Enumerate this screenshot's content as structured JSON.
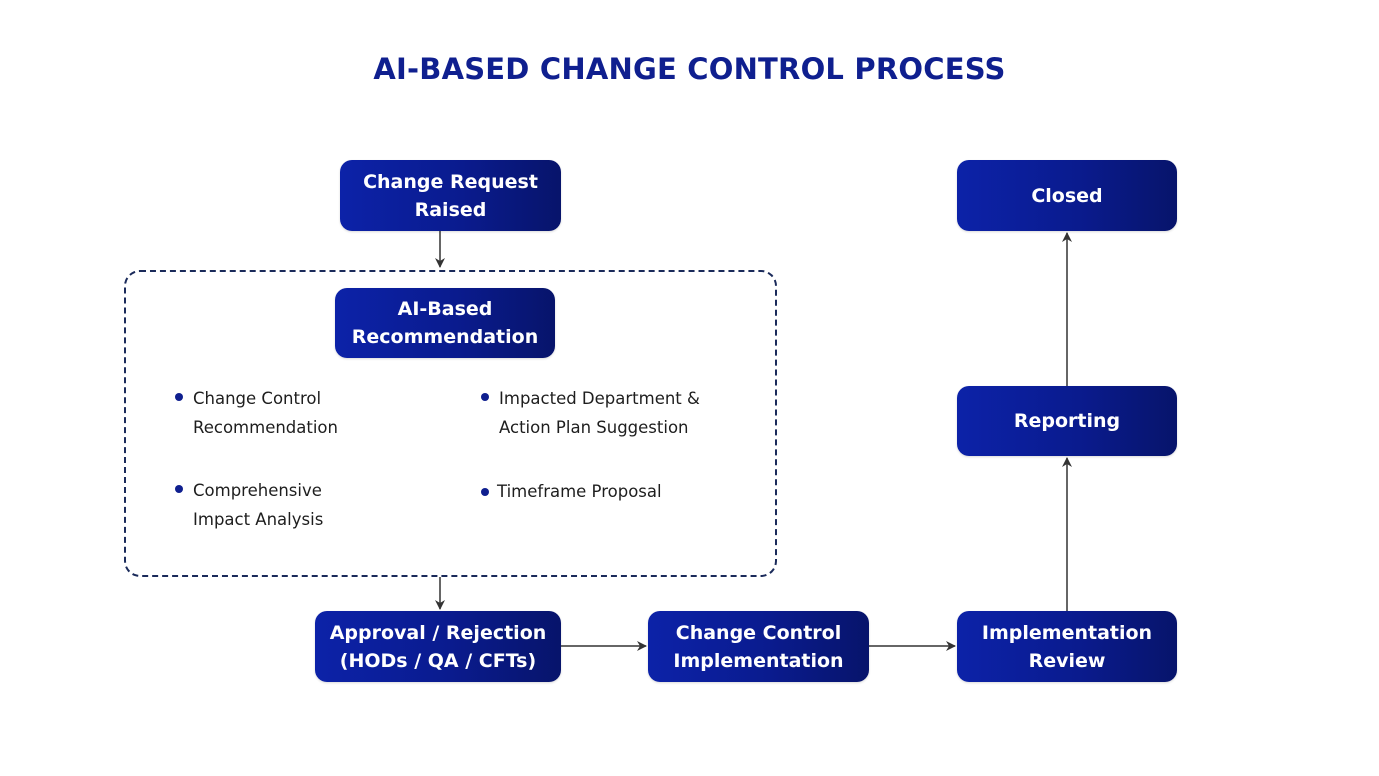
{
  "title": "AI-BASED CHANGE CONTROL PROCESS",
  "nodes": {
    "change_request": "Change Request\nRaised",
    "ai_recommendation": "AI-Based\nRecommendation",
    "approval": "Approval / Rejection\n(HODs / QA / CFTs)",
    "implementation": "Change Control\nImplementation",
    "review": "Implementation\nReview",
    "reporting": "Reporting",
    "closed": "Closed"
  },
  "ai_group": {
    "bullets": [
      "Change Control\nRecommendation",
      "Impacted  Department &\nAction Plan Suggestion",
      "Comprehensive\nImpact Analysis",
      "Timeframe Proposal"
    ]
  },
  "edges": [
    {
      "from": "change_request",
      "to": "ai_group"
    },
    {
      "from": "ai_group",
      "to": "approval"
    },
    {
      "from": "approval",
      "to": "implementation"
    },
    {
      "from": "implementation",
      "to": "review"
    },
    {
      "from": "review",
      "to": "reporting"
    },
    {
      "from": "reporting",
      "to": "closed"
    }
  ],
  "colors": {
    "node_fill": "#0a1b8e",
    "title": "#0f1f8f",
    "connector": "#333333",
    "group_border": "#1a2a5a"
  }
}
